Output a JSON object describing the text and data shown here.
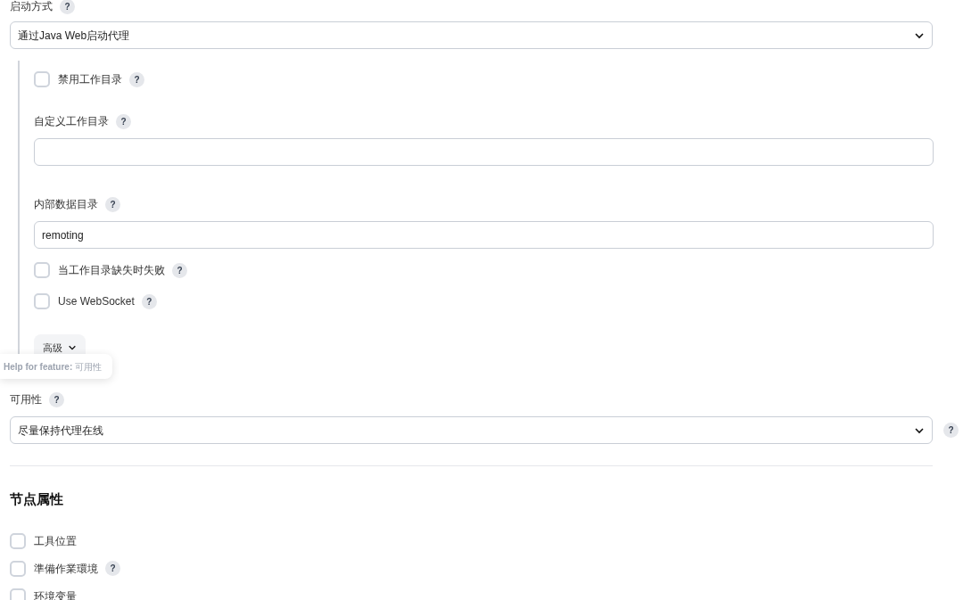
{
  "launch_method": {
    "label": "启动方式",
    "help": "?",
    "value": "通过Java Web启动代理"
  },
  "agent_options": [
    {
      "kind": "checkbox",
      "label": "禁用工作目录",
      "help": "?",
      "checked": false
    },
    {
      "kind": "field",
      "label": "自定义工作目录",
      "help": "?"
    },
    {
      "kind": "field",
      "label": "内部数据目录",
      "help": "?",
      "value": "remoting"
    },
    {
      "kind": "checkbox",
      "label": "当工作目录缺失时失败",
      "help": "?",
      "checked": false
    },
    {
      "kind": "checkbox",
      "label": "Use WebSocket",
      "help": "?",
      "checked": false
    }
  ],
  "advanced_button": {
    "label": "高级"
  },
  "tooltip": {
    "text": "**Help for feature:** 可用性"
  },
  "availability": {
    "label": "可用性",
    "help": "?",
    "value": "尽量保持代理在线",
    "side_help": "?"
  },
  "node_properties": {
    "title": "节点属性",
    "items": [
      {
        "label": "工具位置",
        "checked": false
      },
      {
        "label": "準備作業環境",
        "help": "?",
        "checked": false
      },
      {
        "label": "环境变量",
        "checked": false
      }
    ]
  }
}
